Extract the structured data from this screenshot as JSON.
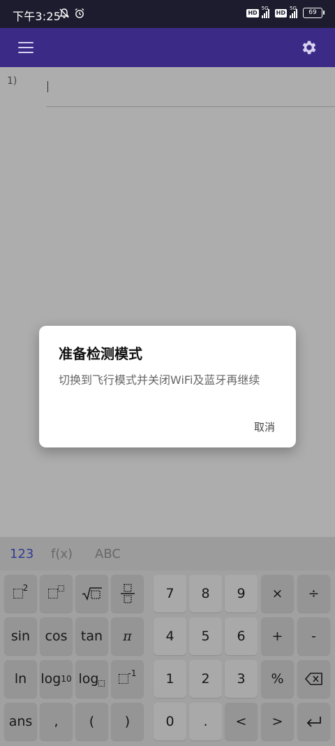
{
  "status_bar": {
    "time": "下午3:25",
    "hd1": "HD",
    "net1": "5G",
    "hd2": "HD",
    "net2": "5G",
    "battery": "69"
  },
  "app_bar": {
    "menu_icon": "hamburger-menu-icon",
    "settings_icon": "gear-icon"
  },
  "editor": {
    "line_number": "1)"
  },
  "keyboard": {
    "tabs": [
      {
        "label": "123",
        "active": true
      },
      {
        "label": "f(x)",
        "active": false
      },
      {
        "label": "ABC",
        "active": false
      }
    ],
    "keys": {
      "square_sup": "2",
      "pi": "π",
      "sin": "sin",
      "cos": "cos",
      "tan": "tan",
      "ln": "ln",
      "log": "log",
      "log_base": "10",
      "inverse_sup": "-1",
      "ans": "ans",
      "comma": ",",
      "lparen": "(",
      "rparen": ")",
      "seven": "7",
      "eight": "8",
      "nine": "9",
      "times": "×",
      "divide": "÷",
      "four": "4",
      "five": "5",
      "six": "6",
      "plus": "+",
      "minus": "-",
      "one": "1",
      "two": "2",
      "three": "3",
      "percent": "%",
      "zero": "0",
      "dot": ".",
      "left": "<",
      "right": ">"
    }
  },
  "dialog": {
    "title": "准备检测模式",
    "message": "切换到飞行模式并关闭WiFi及蓝牙再继续",
    "cancel": "取消"
  }
}
